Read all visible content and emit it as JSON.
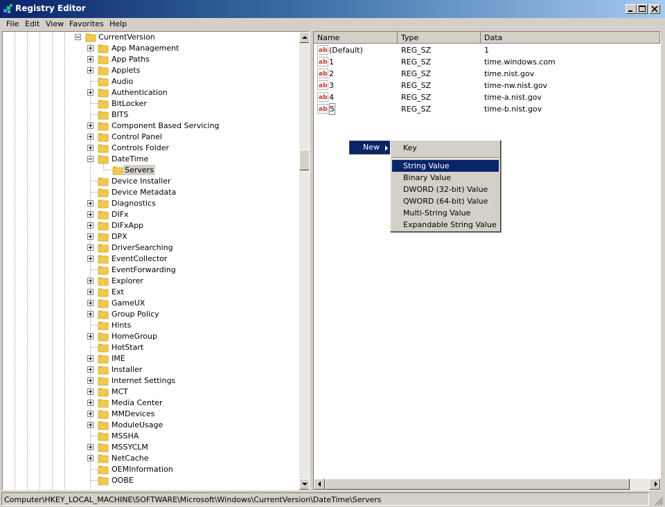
{
  "window": {
    "title": "Registry Editor"
  },
  "menubar": [
    "File",
    "Edit",
    "View",
    "Favorites",
    "Help"
  ],
  "tree": {
    "parent": "CurrentVersion",
    "children": [
      {
        "label": "App Management",
        "expandable": true
      },
      {
        "label": "App Paths",
        "expandable": true
      },
      {
        "label": "Applets",
        "expandable": true
      },
      {
        "label": "Audio",
        "expandable": false
      },
      {
        "label": "Authentication",
        "expandable": true
      },
      {
        "label": "BitLocker",
        "expandable": false
      },
      {
        "label": "BITS",
        "expandable": false
      },
      {
        "label": "Component Based Servicing",
        "expandable": true
      },
      {
        "label": "Control Panel",
        "expandable": true
      },
      {
        "label": "Controls Folder",
        "expandable": true
      },
      {
        "label": "DateTime",
        "expandable": true,
        "expanded": true
      },
      {
        "label": "Servers",
        "expandable": false,
        "child": true,
        "selected": true
      },
      {
        "label": "Device Installer",
        "expandable": false
      },
      {
        "label": "Device Metadata",
        "expandable": false
      },
      {
        "label": "Diagnostics",
        "expandable": true
      },
      {
        "label": "DIFx",
        "expandable": true
      },
      {
        "label": "DIFxApp",
        "expandable": true
      },
      {
        "label": "DPX",
        "expandable": true
      },
      {
        "label": "DriverSearching",
        "expandable": true
      },
      {
        "label": "EventCollector",
        "expandable": true
      },
      {
        "label": "EventForwarding",
        "expandable": false
      },
      {
        "label": "Explorer",
        "expandable": true
      },
      {
        "label": "Ext",
        "expandable": true
      },
      {
        "label": "GameUX",
        "expandable": true
      },
      {
        "label": "Group Policy",
        "expandable": true
      },
      {
        "label": "Hints",
        "expandable": false
      },
      {
        "label": "HomeGroup",
        "expandable": true
      },
      {
        "label": "HotStart",
        "expandable": false
      },
      {
        "label": "IME",
        "expandable": true
      },
      {
        "label": "Installer",
        "expandable": true
      },
      {
        "label": "Internet Settings",
        "expandable": true
      },
      {
        "label": "MCT",
        "expandable": true
      },
      {
        "label": "Media Center",
        "expandable": true
      },
      {
        "label": "MMDevices",
        "expandable": true
      },
      {
        "label": "ModuleUsage",
        "expandable": true
      },
      {
        "label": "MSSHA",
        "expandable": false
      },
      {
        "label": "MSSYCLM",
        "expandable": true
      },
      {
        "label": "NetCache",
        "expandable": true
      },
      {
        "label": "OEMInformation",
        "expandable": false
      },
      {
        "label": "OOBE",
        "expandable": false
      }
    ]
  },
  "list": {
    "columns": [
      "Name",
      "Type",
      "Data"
    ],
    "rows": [
      {
        "name": "(Default)",
        "type": "REG_SZ",
        "data": "1"
      },
      {
        "name": "1",
        "type": "REG_SZ",
        "data": "time.windows.com"
      },
      {
        "name": "2",
        "type": "REG_SZ",
        "data": "time.nist.gov"
      },
      {
        "name": "3",
        "type": "REG_SZ",
        "data": "time-nw.nist.gov"
      },
      {
        "name": "4",
        "type": "REG_SZ",
        "data": "time-a.nist.gov"
      },
      {
        "name": "5",
        "type": "REG_SZ",
        "data": "time-b.nist.gov"
      }
    ]
  },
  "context_menu": {
    "new_label": "New",
    "submenu": [
      "Key",
      "String Value",
      "Binary Value",
      "DWORD (32-bit) Value",
      "QWORD (64-bit) Value",
      "Multi-String Value",
      "Expandable String Value"
    ],
    "highlighted": "String Value"
  },
  "statusbar": {
    "path": "Computer\\HKEY_LOCAL_MACHINE\\SOFTWARE\\Microsoft\\Windows\\CurrentVersion\\DateTime\\Servers"
  },
  "colors": {
    "title_active": "#0a246a",
    "selection": "#0a246a",
    "chrome": "#d4d0c8",
    "folder": "#f2c94c",
    "ab_icon": "#c0392b"
  },
  "icons": {
    "app": "registry-app-icon",
    "folder": "folder-icon",
    "string_value": "ab-string-icon",
    "submenu_arrow": "right-arrow-icon"
  }
}
